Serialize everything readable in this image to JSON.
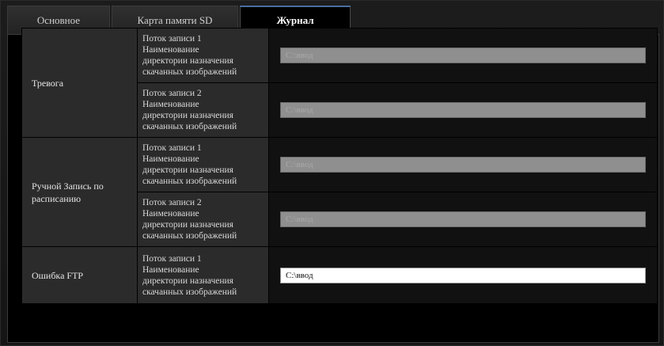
{
  "tabs": [
    {
      "label": "Основное"
    },
    {
      "label": "Карта памяти SD"
    },
    {
      "label": "Журнал"
    }
  ],
  "rows": [
    {
      "group": "Тревога",
      "items": [
        {
          "stream": "Поток записи 1",
          "desc": [
            "Наименование",
            "директории назначения",
            "скачанных изображений"
          ],
          "value": "C:\\ввод",
          "enabled": false
        },
        {
          "stream": "Поток записи 2",
          "desc": [
            "Наименование",
            "директории назначения",
            "скачанных изображений"
          ],
          "value": "C:\\ввод",
          "enabled": false
        }
      ]
    },
    {
      "group": "Ручной Запись по расписанию",
      "items": [
        {
          "stream": "Поток записи 1",
          "desc": [
            "Наименование",
            "директории назначения",
            "скачанных изображений"
          ],
          "value": "C:\\ввод",
          "enabled": false
        },
        {
          "stream": "Поток записи 2",
          "desc": [
            "Наименование",
            "директории назначения",
            "скачанных изображений"
          ],
          "value": "C:\\ввод",
          "enabled": false
        }
      ]
    },
    {
      "group": "Ошибка FTP",
      "items": [
        {
          "stream": "Поток записи 1",
          "desc": [
            "Наименование",
            "директории назначения",
            "скачанных изображений"
          ],
          "value": "C:\\ввод",
          "enabled": true
        }
      ]
    }
  ]
}
